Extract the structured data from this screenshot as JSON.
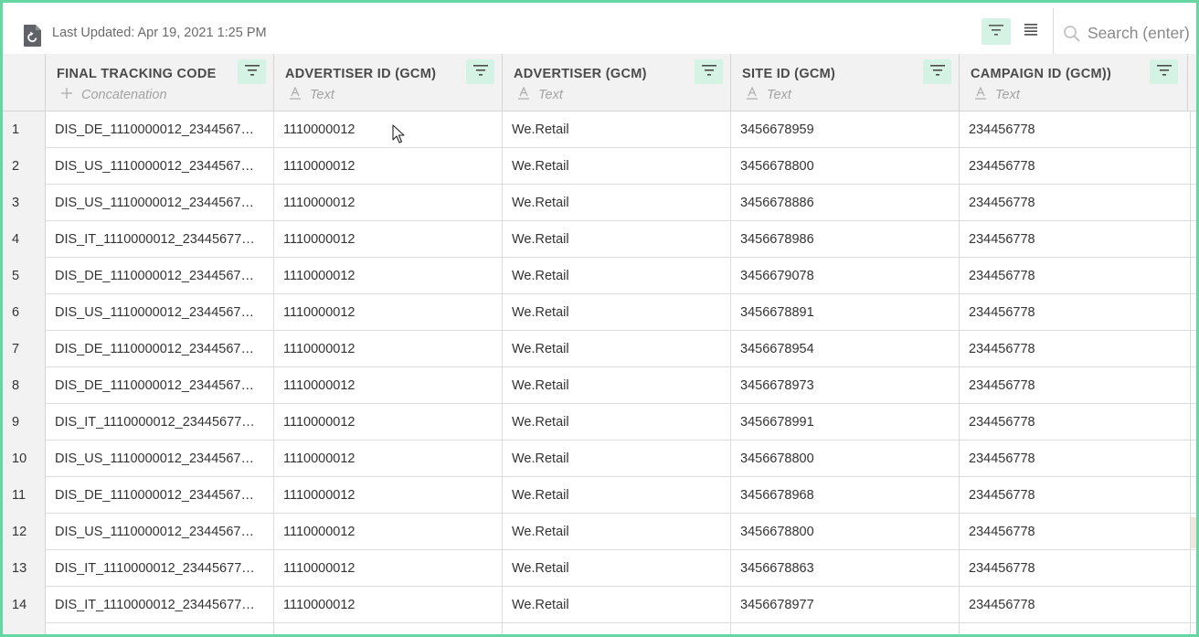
{
  "toolbar": {
    "icon": "document-refresh-icon",
    "last_updated": "Last Updated: Apr 19, 2021 1:25 PM",
    "filter_icon": "filter-icon",
    "list_icon": "list-icon",
    "search_placeholder": "Search (enter)"
  },
  "colors": {
    "accent": "#66d6a3",
    "filter_bg": "#d5f3e5",
    "header_bg": "#f2f2f2"
  },
  "columns": [
    {
      "title": "FINAL TRACKING CODE",
      "type_label": "Concatenation",
      "type_icon": "plus-icon"
    },
    {
      "title": "ADVERTISER ID (GCM)",
      "type_label": "Text",
      "type_icon": "text-type-icon"
    },
    {
      "title": "ADVERTISER (GCM)",
      "type_label": "Text",
      "type_icon": "text-type-icon"
    },
    {
      "title": "SITE ID (GCM)",
      "type_label": "Text",
      "type_icon": "text-type-icon"
    },
    {
      "title": "CAMPAIGN ID (GCM))",
      "type_label": "Text",
      "type_icon": "text-type-icon"
    }
  ],
  "rows": [
    {
      "num": "1",
      "cells": [
        "DIS_DE_1110000012_2344567…",
        "1110000012",
        "We.Retail",
        "3456678959",
        "234456778"
      ]
    },
    {
      "num": "2",
      "cells": [
        "DIS_US_1110000012_2344567…",
        "1110000012",
        "We.Retail",
        "3456678800",
        "234456778"
      ]
    },
    {
      "num": "3",
      "cells": [
        "DIS_US_1110000012_2344567…",
        "1110000012",
        "We.Retail",
        "3456678886",
        "234456778"
      ]
    },
    {
      "num": "4",
      "cells": [
        "DIS_IT_1110000012_23445677…",
        "1110000012",
        "We.Retail",
        "3456678986",
        "234456778"
      ]
    },
    {
      "num": "5",
      "cells": [
        "DIS_DE_1110000012_2344567…",
        "1110000012",
        "We.Retail",
        "3456679078",
        "234456778"
      ]
    },
    {
      "num": "6",
      "cells": [
        "DIS_US_1110000012_2344567…",
        "1110000012",
        "We.Retail",
        "3456678891",
        "234456778"
      ]
    },
    {
      "num": "7",
      "cells": [
        "DIS_DE_1110000012_2344567…",
        "1110000012",
        "We.Retail",
        "3456678954",
        "234456778"
      ]
    },
    {
      "num": "8",
      "cells": [
        "DIS_DE_1110000012_2344567…",
        "1110000012",
        "We.Retail",
        "3456678973",
        "234456778"
      ]
    },
    {
      "num": "9",
      "cells": [
        "DIS_IT_1110000012_23445677…",
        "1110000012",
        "We.Retail",
        "3456678991",
        "234456778"
      ]
    },
    {
      "num": "10",
      "cells": [
        "DIS_US_1110000012_2344567…",
        "1110000012",
        "We.Retail",
        "3456678800",
        "234456778"
      ]
    },
    {
      "num": "11",
      "cells": [
        "DIS_DE_1110000012_2344567…",
        "1110000012",
        "We.Retail",
        "3456678968",
        "234456778"
      ]
    },
    {
      "num": "12",
      "cells": [
        "DIS_US_1110000012_2344567…",
        "1110000012",
        "We.Retail",
        "3456678800",
        "234456778"
      ]
    },
    {
      "num": "13",
      "cells": [
        "DIS_IT_1110000012_23445677…",
        "1110000012",
        "We.Retail",
        "3456678863",
        "234456778"
      ]
    },
    {
      "num": "14",
      "cells": [
        "DIS_IT_1110000012_23445677…",
        "1110000012",
        "We.Retail",
        "3456678977",
        "234456778"
      ]
    },
    {
      "num": "",
      "cells": [
        "",
        "",
        "",
        "",
        ""
      ]
    }
  ]
}
